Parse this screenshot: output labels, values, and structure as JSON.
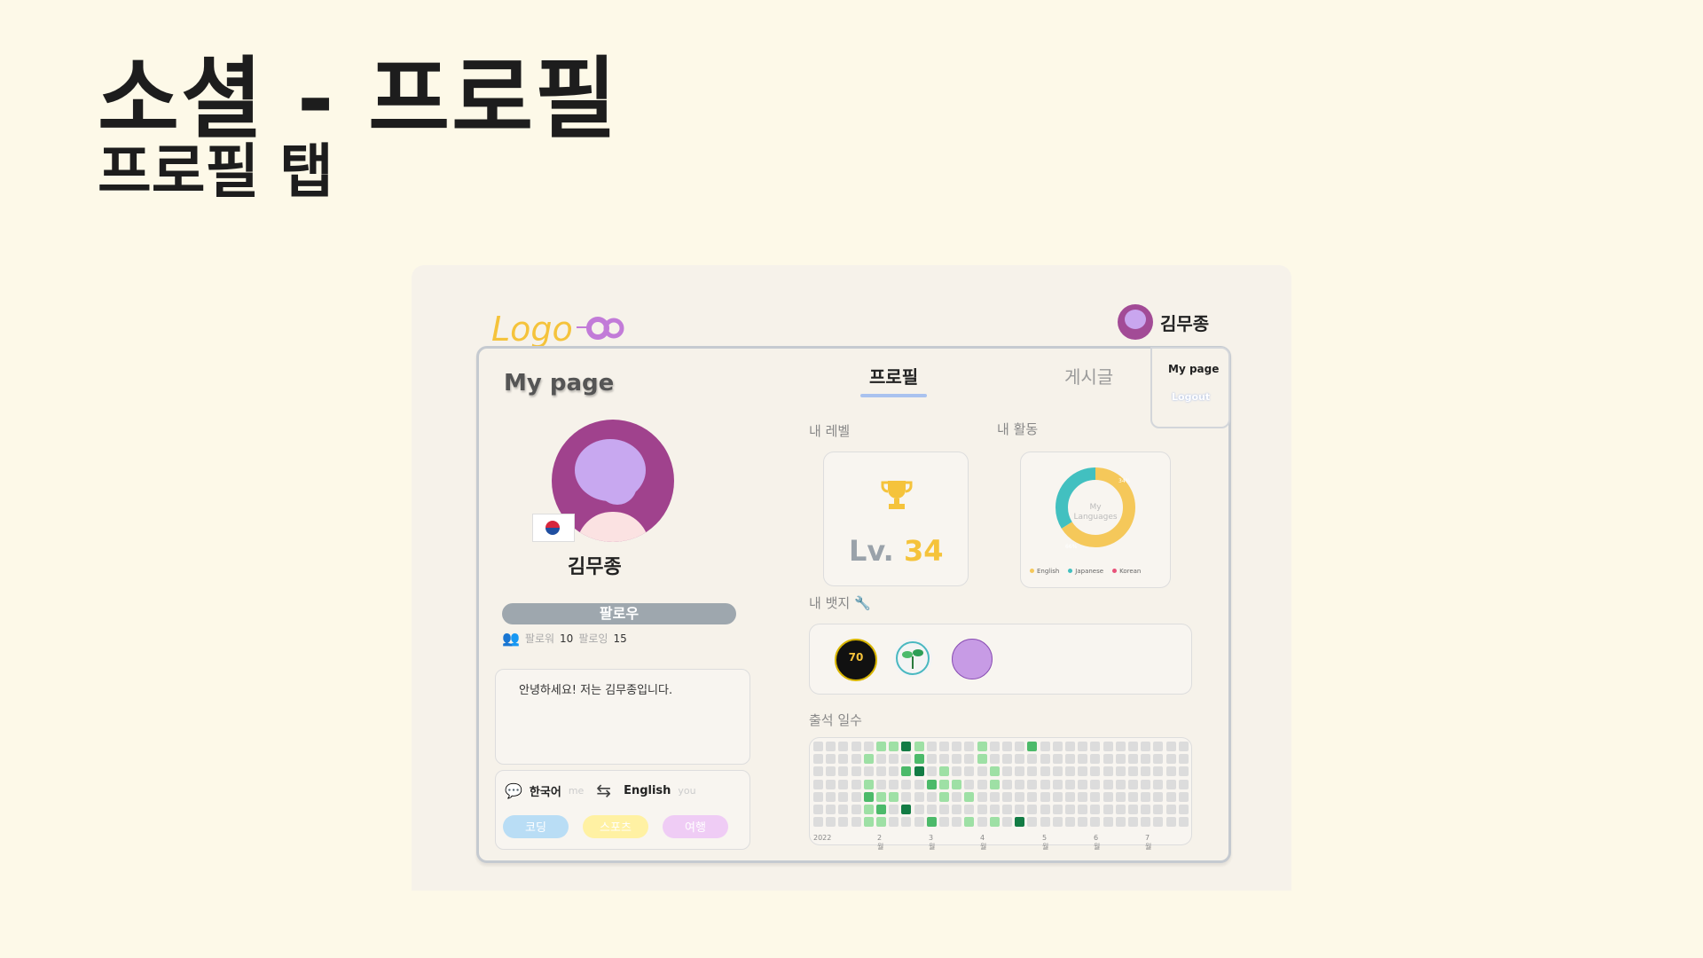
{
  "slide": {
    "title": "소셜 - 프로필",
    "subtitle": "프로필 탭"
  },
  "app": {
    "logo": "Logo",
    "user": {
      "name": "김무종"
    },
    "dropdown": {
      "mypage": "My page",
      "logout": "Logout"
    }
  },
  "card": {
    "title": "My page",
    "tabs": [
      {
        "label": "프로필",
        "active": true
      },
      {
        "label": "게시글",
        "active": false
      }
    ]
  },
  "profile": {
    "name": "김무종",
    "follow_button": "팔로우",
    "followers_label": "팔로워",
    "followers": "10",
    "following_label": "팔로잉",
    "following": "15",
    "bio": "안녕하세요! 저는 김무종입니다.",
    "native_language": "한국어",
    "native_sub": "me",
    "target_language": "English",
    "target_sub": "you",
    "interests": [
      "코딩",
      "스포츠",
      "여행"
    ]
  },
  "sections": {
    "level_label": "내 레벨",
    "activity_label": "내 활동",
    "badges_label": "내 뱃지",
    "attendance_label": "출석 일수"
  },
  "level": {
    "prefix": "Lv.",
    "value": "34"
  },
  "activity": {
    "center_line1": "My",
    "center_line2": "Languages",
    "segments": [
      {
        "label": "English",
        "percent": 66,
        "color": "#f5c85a"
      },
      {
        "label": "Japanese",
        "percent": 34,
        "color": "#42c0c0"
      },
      {
        "label": "Korean",
        "percent": 0,
        "color": "#e8527a"
      }
    ],
    "pct_labels": [
      "34%",
      "66%"
    ]
  },
  "badges": [
    {
      "icon": "level-70-badge-icon",
      "text": "70"
    },
    {
      "icon": "sprout-badge-icon",
      "text": ""
    },
    {
      "icon": "purple-badge-icon",
      "text": ""
    }
  ],
  "attendance": {
    "month_labels": [
      "2022",
      "2월",
      "3월",
      "4월",
      "5월",
      "6월",
      "7월"
    ],
    "levels": [
      [
        0,
        0,
        0,
        0,
        0,
        1,
        1,
        3,
        1,
        0,
        0,
        0,
        0,
        1,
        0,
        0,
        0,
        2,
        0,
        0,
        0,
        0,
        0,
        0,
        0,
        0,
        0,
        0,
        0,
        0
      ],
      [
        0,
        0,
        0,
        0,
        1,
        0,
        0,
        0,
        2,
        0,
        0,
        0,
        0,
        1,
        0,
        0,
        0,
        0,
        0,
        0,
        0,
        0,
        0,
        0,
        0,
        0,
        0,
        0,
        0,
        0
      ],
      [
        0,
        0,
        0,
        0,
        0,
        0,
        0,
        2,
        3,
        0,
        1,
        0,
        0,
        0,
        1,
        0,
        0,
        0,
        0,
        0,
        0,
        0,
        0,
        0,
        0,
        0,
        0,
        0,
        0,
        0
      ],
      [
        0,
        0,
        0,
        0,
        1,
        0,
        0,
        0,
        0,
        2,
        1,
        1,
        0,
        0,
        1,
        0,
        0,
        0,
        0,
        0,
        0,
        0,
        0,
        0,
        0,
        0,
        0,
        0,
        0,
        0
      ],
      [
        0,
        0,
        0,
        0,
        2,
        1,
        1,
        0,
        0,
        0,
        1,
        0,
        1,
        0,
        0,
        0,
        0,
        0,
        0,
        0,
        0,
        0,
        0,
        0,
        0,
        0,
        0,
        0,
        0,
        0
      ],
      [
        0,
        0,
        0,
        0,
        1,
        2,
        0,
        3,
        0,
        0,
        0,
        0,
        0,
        0,
        0,
        0,
        0,
        0,
        0,
        0,
        0,
        0,
        0,
        0,
        0,
        0,
        0,
        0,
        0,
        0
      ],
      [
        0,
        0,
        0,
        0,
        1,
        1,
        0,
        0,
        0,
        2,
        0,
        0,
        1,
        0,
        1,
        0,
        3,
        0,
        0,
        0,
        0,
        0,
        0,
        0,
        0,
        0,
        0,
        0,
        0,
        0
      ]
    ],
    "colors": [
      "#dcdcdc",
      "#9ee0a5",
      "#4cba6a",
      "#137c45"
    ]
  }
}
